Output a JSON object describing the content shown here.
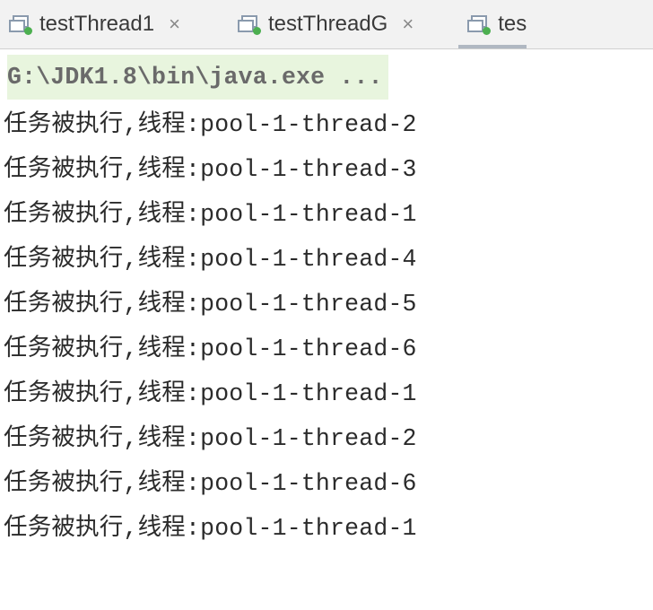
{
  "tabs": [
    {
      "label": "testThread1",
      "closable": true
    },
    {
      "label": "testThreadG",
      "closable": true
    },
    {
      "label": "tes",
      "closable": false
    }
  ],
  "console": {
    "command": "G:\\JDK1.8\\bin\\java.exe ...",
    "lines": [
      "任务被执行,线程:pool-1-thread-2",
      "任务被执行,线程:pool-1-thread-3",
      "任务被执行,线程:pool-1-thread-1",
      "任务被执行,线程:pool-1-thread-4",
      "任务被执行,线程:pool-1-thread-5",
      "任务被执行,线程:pool-1-thread-6",
      "任务被执行,线程:pool-1-thread-1",
      "任务被执行,线程:pool-1-thread-2",
      "任务被执行,线程:pool-1-thread-6",
      "任务被执行,线程:pool-1-thread-1"
    ]
  }
}
